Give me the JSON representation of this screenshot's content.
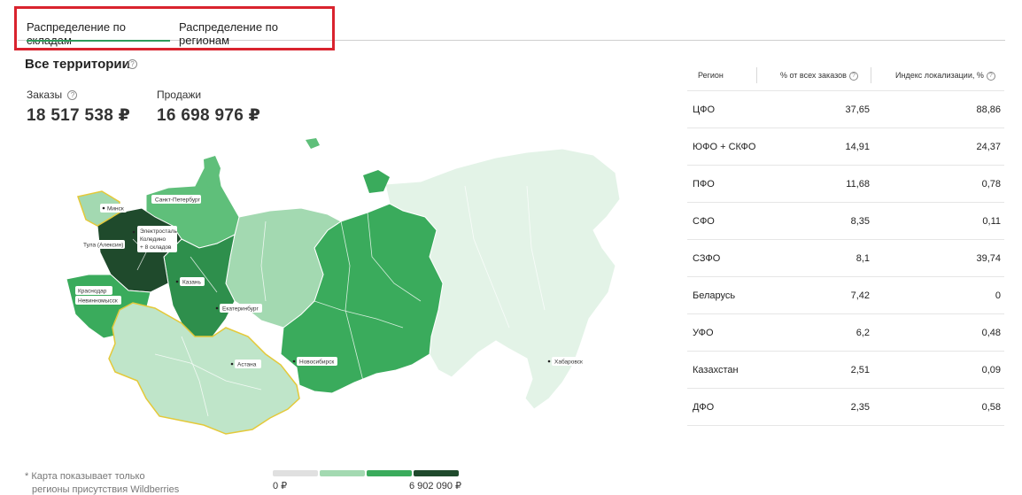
{
  "tabs": [
    {
      "label": "Распределение по складам",
      "active": true
    },
    {
      "label": "Распределение по регионам",
      "active": false
    }
  ],
  "section_title": "Все территории",
  "metrics": {
    "orders_label": "Заказы",
    "orders_value": "18 517 538 ₽",
    "sales_label": "Продажи",
    "sales_value": "16 698 976 ₽"
  },
  "map": {
    "labels": [
      "Минск",
      "Санкт-Петербург",
      "Электросталь",
      "Коледино",
      "+ 8 складов",
      "Тула (Алексин)",
      "Казань",
      "Краснодар",
      "Невинномысск",
      "Екатеринбург",
      "Астана",
      "Новосибирск",
      "Хабаровск"
    ]
  },
  "legend": {
    "note_line1": "* Карта показывает только",
    "note_line2": "регионы присутствия Wildberries",
    "min": "0 ₽",
    "max": "6 902 090 ₽",
    "colors": [
      "#e0e0e0",
      "#a3d9b1",
      "#3aab5c",
      "#1f4a2c"
    ]
  },
  "table": {
    "headers": {
      "region": "Регион",
      "share": "% от всех заказов",
      "index": "Индекс локализации, %"
    },
    "rows": [
      {
        "region": "ЦФО",
        "share": "37,65",
        "index": "88,86"
      },
      {
        "region": "ЮФО + СКФО",
        "share": "14,91",
        "index": "24,37"
      },
      {
        "region": "ПФО",
        "share": "11,68",
        "index": "0,78"
      },
      {
        "region": "СФО",
        "share": "8,35",
        "index": "0,11"
      },
      {
        "region": "СЗФО",
        "share": "8,1",
        "index": "39,74"
      },
      {
        "region": "Беларусь",
        "share": "7,42",
        "index": "0"
      },
      {
        "region": "УФО",
        "share": "6,2",
        "index": "0,48"
      },
      {
        "region": "Казахстан",
        "share": "2,51",
        "index": "0,09"
      },
      {
        "region": "ДФО",
        "share": "2,35",
        "index": "0,58"
      }
    ]
  }
}
